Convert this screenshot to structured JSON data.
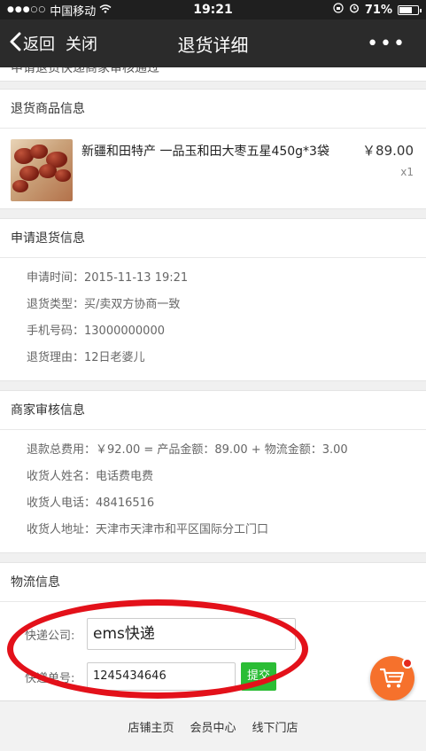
{
  "status_bar": {
    "carrier": "中国移动",
    "time": "19:21",
    "battery": "71%",
    "battery_level": 0.71
  },
  "nav": {
    "back_label": "返回",
    "close_label": "关闭",
    "title": "退货详细",
    "more_label": "•••"
  },
  "cut_text": "申请退货快递商家审核通过",
  "product_section": {
    "header": "退货商品信息",
    "name": "新疆和田特产 一品玉和田大枣五星450g*3袋",
    "price": "￥89.00",
    "qty": "x1"
  },
  "apply_section": {
    "header": "申请退货信息",
    "rows": [
      {
        "label": "申请时间：",
        "value": "2015-11-13 19:21"
      },
      {
        "label": "退货类型：",
        "value": "买/卖双方协商一致"
      },
      {
        "label": "手机号码：",
        "value": "13000000000"
      },
      {
        "label": "退货理由：",
        "value": "12日老婆儿"
      }
    ]
  },
  "review_section": {
    "header": "商家审核信息",
    "rows": [
      {
        "label": "退款总费用：",
        "value": "￥92.00 = 产品金额：89.00 + 物流金额：3.00"
      },
      {
        "label": "收货人姓名：",
        "value": "电话费电费"
      },
      {
        "label": "收货人电话：",
        "value": "48416516"
      },
      {
        "label": "收货人地址：",
        "value": "天津市天津市和平区国际分工门口"
      }
    ]
  },
  "logistics_section": {
    "header": "物流信息",
    "company_label": "快递公司:",
    "company_value": "ems快递",
    "tracking_label": "快递单号:",
    "tracking_value": "1245434646",
    "submit_label": "提交"
  },
  "footer": {
    "links": [
      "店铺主页",
      "会员中心",
      "线下门店"
    ]
  },
  "colors": {
    "nav_bg": "#2b2b2b",
    "submit_green": "#2bbd35",
    "annotation_red": "#e3111a",
    "cart_orange": "#f6712c"
  }
}
